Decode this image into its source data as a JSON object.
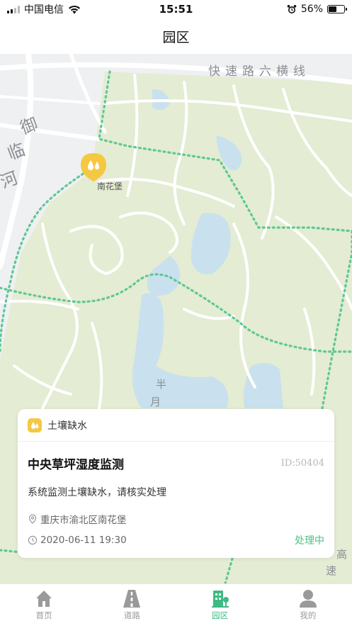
{
  "status_bar": {
    "carrier": "中国电信",
    "time": "15:51",
    "battery": "56%"
  },
  "nav": {
    "title": "园区"
  },
  "map": {
    "labels": {
      "road_top": "快速路六横线",
      "road_left_1": "御",
      "road_left_2": "临",
      "road_left_3": "河",
      "lake_1": "半",
      "lake_2": "月",
      "road_right_1": "高",
      "road_right_2": "速"
    },
    "poi": {
      "name": "南花堡"
    }
  },
  "alert": {
    "type": "土壤缺水",
    "title": "中央草坪湿度监测",
    "id": "ID:50404",
    "description": "系统监测土壤缺水，请核实处理",
    "location": "重庆市渝北区南花堡",
    "time": "2020-06-11 19:30",
    "status": "处理中"
  },
  "tabs": [
    {
      "label": "首页",
      "icon": "home-icon"
    },
    {
      "label": "道路",
      "icon": "road-icon"
    },
    {
      "label": "园区",
      "icon": "park-icon"
    },
    {
      "label": "我的",
      "icon": "user-icon"
    }
  ],
  "colors": {
    "accent": "#3fba84",
    "warning": "#f5c842",
    "park_fill": "#e4ecd3",
    "water": "#c9e1ee"
  }
}
